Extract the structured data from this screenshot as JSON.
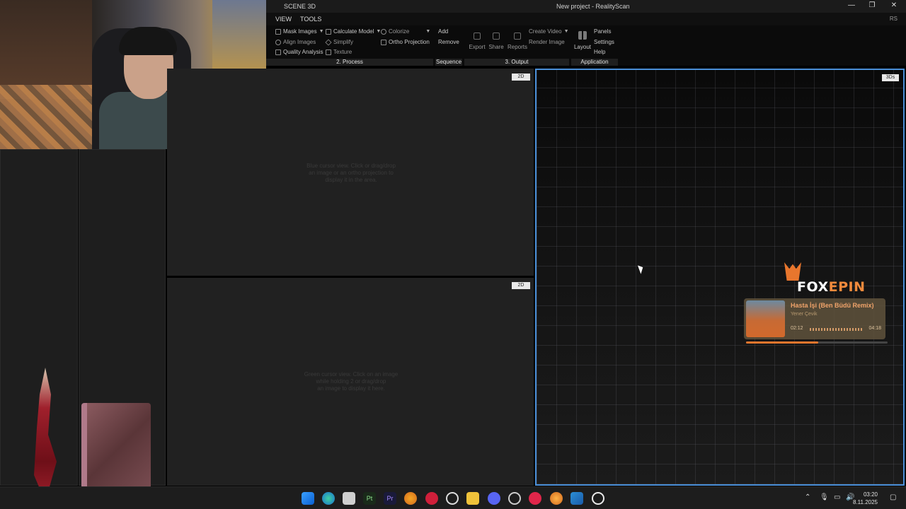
{
  "window": {
    "scene_label": "SCENE 3D",
    "title": "New project - RealityScan",
    "controls": [
      "—",
      "❐",
      "✕"
    ]
  },
  "menu": {
    "tabs": [
      "VIEW",
      "TOOLS"
    ],
    "corner_label": "RS"
  },
  "ribbon": {
    "mask_images": "Mask Images",
    "align_images": "Align Images",
    "quality_analysis": "Quality Analysis",
    "calculate_model": "Calculate Model",
    "simplify": "Simplify",
    "texture": "Texture",
    "colorize": "Colorize",
    "ortho_projection": "Ortho Projection",
    "add": "Add",
    "remove": "Remove",
    "export": "Export",
    "share": "Share",
    "reports": "Reports",
    "create_video": "Create Video",
    "render_image": "Render Image",
    "layout": "Layout",
    "panels": "Panels",
    "settings": "Settings",
    "help": "Help",
    "sections": {
      "process": "2. Process",
      "sequence": "Sequence",
      "output": "3. Output",
      "application": "Application"
    }
  },
  "views": {
    "top2d": {
      "badge": "2D",
      "hint": [
        "Blue cursor view. Click or drag/drop",
        "an image or an ortho projection to",
        "display it in the area."
      ]
    },
    "bottom2d": {
      "badge": "2D",
      "hint": [
        "Green cursor view. Click on an image",
        "while holding 2 or drag/drop",
        "an image to display it here."
      ]
    },
    "view3d": {
      "badge": "3Ds"
    }
  },
  "overlay": {
    "logo_fox": "FOX",
    "logo_pin": "EPIN",
    "song": "Hasta İşi (Ben Büdü Remix)",
    "artist": "Yener Çevik",
    "elapsed": "02:12",
    "duration": "04:18",
    "progress": 0.51
  },
  "taskbar": {
    "time": "03:20",
    "date": "8.11.2025"
  },
  "colors": {
    "accent": "#4a8fd8",
    "brand_orange": "#e8762d"
  }
}
